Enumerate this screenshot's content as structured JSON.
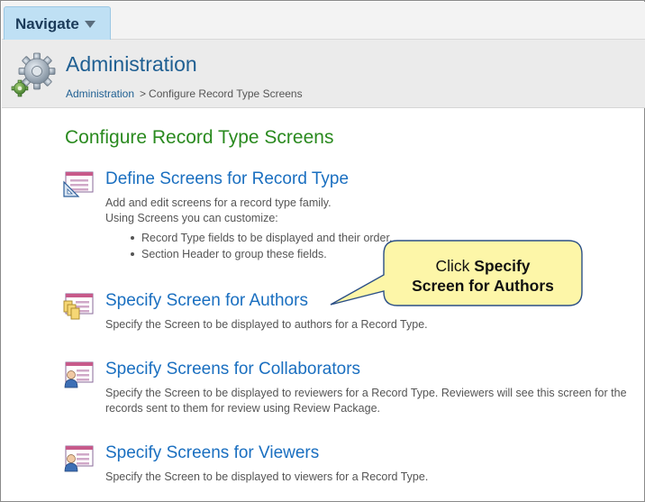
{
  "nav": {
    "label": "Navigate"
  },
  "header": {
    "title": "Administration",
    "breadcrumb": {
      "root": "Administration",
      "separator": ">",
      "current": "Configure Record Type Screens"
    }
  },
  "page": {
    "title": "Configure Record Type Screens"
  },
  "sections": [
    {
      "title": "Define Screens for Record Type",
      "desc_lines": [
        "Add and edit screens for a record type family.",
        "Using Screens you can customize:"
      ],
      "bullets": [
        "Record Type fields to be displayed and their order.",
        "Section Header to group these fields."
      ],
      "icon": "screen-ruler-icon"
    },
    {
      "title": "Specify Screen for Authors",
      "desc": "Specify the Screen to be displayed to authors for a Record Type.",
      "icon": "author-documents-icon"
    },
    {
      "title": "Specify Screens for Collaborators",
      "desc": "Specify the Screen to be displayed to reviewers for a Record Type. Reviewers will see this screen for the records sent to them for review using Review Package.",
      "icon": "collaborator-user-icon"
    },
    {
      "title": "Specify Screens for Viewers",
      "desc": "Specify the Screen to be displayed to viewers for a Record Type.",
      "icon": "viewer-user-icon"
    }
  ],
  "callout": {
    "prefix": "Click ",
    "bold_1": "Specify",
    "bold_2": "Screen for Authors"
  },
  "colors": {
    "title_green": "#2a8a1f",
    "link_blue": "#1a6fc0",
    "callout_fill": "#fdf6a8"
  }
}
